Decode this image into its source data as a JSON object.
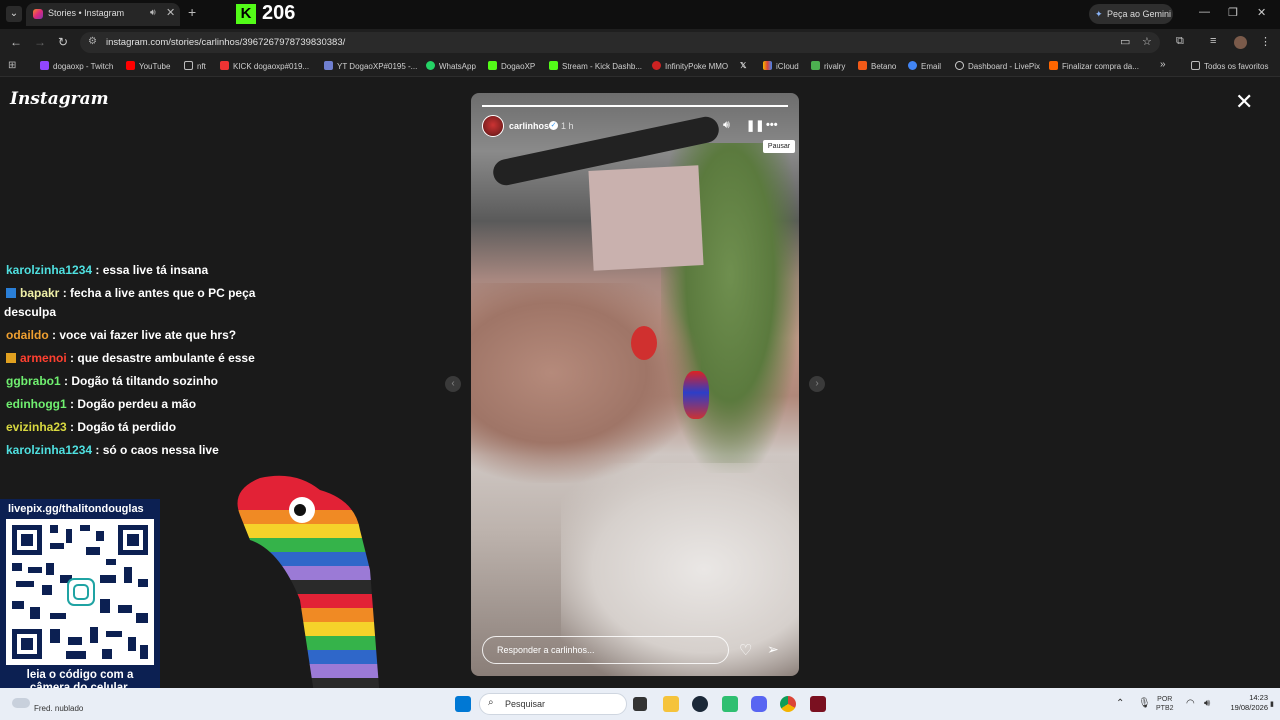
{
  "browser": {
    "tab_title": "Stories • Instagram",
    "kick_count": "206",
    "gemini_label": "Peça ao Gemini",
    "url": "instagram.com/stories/carlinhos/3967267978739830383/",
    "bookmarks": [
      "dogaoxp - Twitch",
      "YouTube",
      "nft",
      "KICK dogaoxp#019...",
      "YT DogaoXP#0195 -...",
      "WhatsApp",
      "DogaoXP",
      "Stream - Kick Dashb...",
      "InfinityPoke MMO",
      "",
      "iCloud",
      "rivalry",
      "Betano",
      "Email",
      "Dashboard - LivePix",
      "Finalizar compra da..."
    ],
    "all_bookmarks": "Todos os favoritos"
  },
  "instagram": {
    "logo": "Instagram",
    "story": {
      "username": "carlinhos",
      "time": "1 h",
      "progress": 1.0,
      "tooltip": "Pausar",
      "reply_placeholder": "Responder a carlinhos..."
    }
  },
  "chat": [
    {
      "user": "karolzinha1234",
      "msg": ": essa live tá insana",
      "color": "#4fe0e0",
      "badge": ""
    },
    {
      "user": "bapakr",
      "msg": ": fecha a live antes que o PC peça",
      "color": "#f0f0a8",
      "badge": "blue"
    },
    {
      "user": "",
      "msg": "desculpa",
      "color": "#ffffff",
      "badge": ""
    },
    {
      "user": "odaildo",
      "msg": ": voce vai fazer live ate que hrs?",
      "color": "#f0a030",
      "badge": ""
    },
    {
      "user": "armenoi",
      "msg": ": que desastre ambulante é esse",
      "color": "#ff4030",
      "badge": "gold"
    },
    {
      "user": "ggbrabo1",
      "msg": ": Dogão tá tiltando sozinho",
      "color": "#70f070",
      "badge": ""
    },
    {
      "user": "edinhogg1",
      "msg": ": Dogão perdeu a mão",
      "color": "#70f070",
      "badge": ""
    },
    {
      "user": "evizinha23",
      "msg": ": Dogão tá perdido",
      "color": "#d8d840",
      "badge": ""
    },
    {
      "user": "karolzinha1234",
      "msg": ": só o caos nessa live",
      "color": "#4fe0e0",
      "badge": ""
    }
  ],
  "qr": {
    "url": "livepix.gg/thalitondouglas",
    "caption_line1": "leia o código com a",
    "caption_line2": "câmera do celular."
  },
  "taskbar": {
    "weather": "Fred. nublado",
    "search": "Pesquisar",
    "lang_1": "POR",
    "lang_2": "PTB2",
    "time": "14:23",
    "date": "19/08/2026"
  }
}
